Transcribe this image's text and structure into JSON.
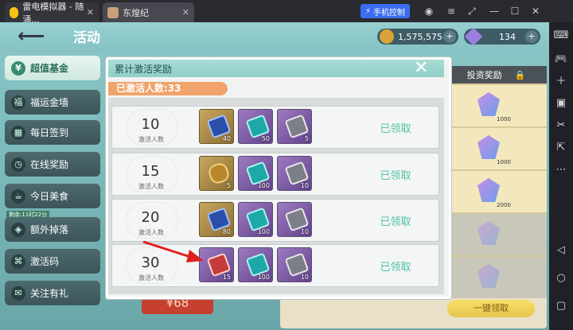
{
  "emulator": {
    "tab1_title": "雷电模拟器 - 随涌...",
    "tab2_title": "东煌纪",
    "control_button": "手机控制"
  },
  "game": {
    "page_title": "活动",
    "resource1": "1,575,575",
    "resource2": "134",
    "sidebar": [
      {
        "label": "超值基金",
        "active": true
      },
      {
        "label": "福运金墙"
      },
      {
        "label": "每日签到"
      },
      {
        "label": "在线奖励"
      },
      {
        "label": "今日美食"
      },
      {
        "label": "额外掉落"
      },
      {
        "label": "激活码"
      },
      {
        "label": "关注有礼"
      }
    ],
    "sidebar_timer": "剩余:11时22分",
    "bg_panel": {
      "header": "投资奖励",
      "gem_values": [
        "1000",
        "1000",
        "2000",
        "",
        ""
      ],
      "claim_all": "一键领取",
      "price": "¥68"
    }
  },
  "dialog": {
    "title": "累计激活奖励",
    "activated_count": "已激活人数:33",
    "tier_label": "激活人数",
    "rows": [
      {
        "threshold": "10",
        "status": "已领取",
        "items": [
          {
            "qty": "40"
          },
          {
            "qty": "50"
          },
          {
            "qty": "5"
          }
        ]
      },
      {
        "threshold": "15",
        "status": "已领取",
        "items": [
          {
            "qty": "5"
          },
          {
            "qty": "100"
          },
          {
            "qty": "10"
          }
        ]
      },
      {
        "threshold": "20",
        "status": "已领取",
        "items": [
          {
            "qty": "80"
          },
          {
            "qty": "100"
          },
          {
            "qty": "10"
          }
        ]
      },
      {
        "threshold": "30",
        "status": "已领取",
        "items": [
          {
            "qty": "15"
          },
          {
            "qty": "100"
          },
          {
            "qty": "10"
          }
        ]
      }
    ]
  }
}
